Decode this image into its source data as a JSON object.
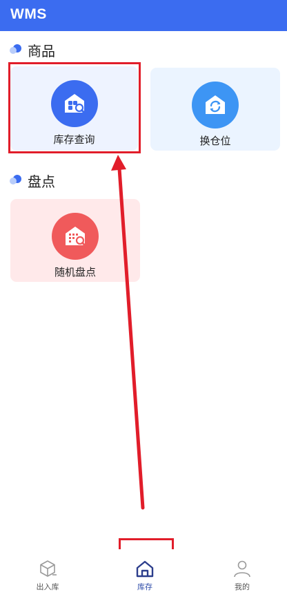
{
  "app": {
    "title": "WMS"
  },
  "sections": {
    "goods": {
      "title": "商品"
    },
    "stocktake": {
      "title": "盘点"
    }
  },
  "cards": {
    "inventory_query": {
      "label": "库存查询",
      "icon": "warehouse-search-icon",
      "color": "#3b6cf0"
    },
    "transfer_location": {
      "label": "换仓位",
      "icon": "warehouse-refresh-icon",
      "color": "#3d95f4"
    },
    "random_stocktake": {
      "label": "随机盘点",
      "icon": "building-search-icon",
      "color": "#f05a5b"
    }
  },
  "tabbar": {
    "items": [
      {
        "label": "出入库",
        "icon": "box-icon",
        "active": false
      },
      {
        "label": "库存",
        "icon": "home-icon",
        "active": true
      },
      {
        "label": "我的",
        "icon": "user-icon",
        "active": false
      }
    ]
  },
  "colors": {
    "primary": "#3b6cf0",
    "annotation": "#e11d2a"
  }
}
